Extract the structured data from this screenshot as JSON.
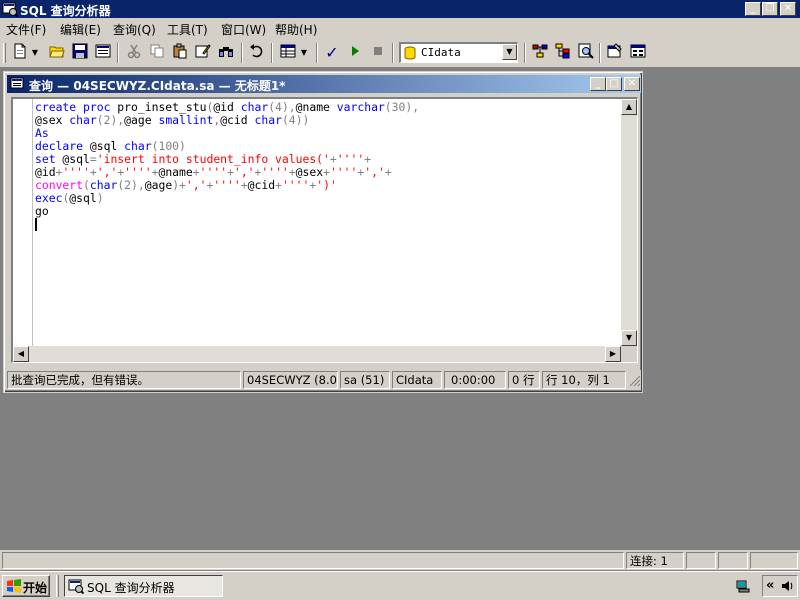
{
  "app": {
    "title": "SQL 查询分析器",
    "window_controls": {
      "minimize": "_",
      "restore": "❐",
      "close": "✕"
    }
  },
  "menu": {
    "items": [
      {
        "label": "文件(F)"
      },
      {
        "label": "编辑(E)"
      },
      {
        "label": "查询(Q)"
      },
      {
        "label": "工具(T)"
      },
      {
        "label": "窗口(W)"
      },
      {
        "label": "帮助(H)"
      }
    ]
  },
  "toolbar": {
    "database_select": "CIdata",
    "icons": [
      "new-query-icon",
      "open-icon",
      "save-icon",
      "load-script-icon",
      "cut-icon",
      "copy-icon",
      "paste-icon",
      "clear-icon",
      "find-icon",
      "undo-icon",
      "results-grid-icon",
      "parse-icon",
      "execute-icon",
      "stop-icon",
      "database-icon",
      "show-plan-icon",
      "object-browser-icon",
      "object-search-icon",
      "properties-icon",
      "current-connection-icon"
    ]
  },
  "query_window": {
    "title": "查询 — 04SECWYZ.CIdata.sa — 无标题1*",
    "code_lines": [
      [
        {
          "t": "create proc",
          "c": "kw"
        },
        {
          "t": " pro_inset_stu",
          "c": ""
        },
        {
          "t": "(",
          "c": "gr"
        },
        {
          "t": "@id ",
          "c": ""
        },
        {
          "t": "char",
          "c": "kw"
        },
        {
          "t": "(4),",
          "c": "gr"
        },
        {
          "t": "@name ",
          "c": ""
        },
        {
          "t": "varchar",
          "c": "kw"
        },
        {
          "t": "(30),",
          "c": "gr"
        }
      ],
      [
        {
          "t": "@sex ",
          "c": ""
        },
        {
          "t": "char",
          "c": "kw"
        },
        {
          "t": "(2),",
          "c": "gr"
        },
        {
          "t": "@age ",
          "c": ""
        },
        {
          "t": "smallint",
          "c": "kw"
        },
        {
          "t": ",",
          "c": "gr"
        },
        {
          "t": "@cid ",
          "c": ""
        },
        {
          "t": "char",
          "c": "kw"
        },
        {
          "t": "(4))",
          "c": "gr"
        }
      ],
      [
        {
          "t": "As",
          "c": "kw"
        }
      ],
      [
        {
          "t": "declare",
          "c": "kw"
        },
        {
          "t": " @sql ",
          "c": ""
        },
        {
          "t": "char",
          "c": "kw"
        },
        {
          "t": "(100)",
          "c": "gr"
        }
      ],
      [
        {
          "t": "set",
          "c": "kw"
        },
        {
          "t": " @sql",
          "c": ""
        },
        {
          "t": "=",
          "c": "gr"
        },
        {
          "t": "'insert into student_info values('",
          "c": "str"
        },
        {
          "t": "+",
          "c": "gr"
        },
        {
          "t": "''''",
          "c": "str"
        },
        {
          "t": "+",
          "c": "gr"
        }
      ],
      [
        {
          "t": "@id",
          "c": ""
        },
        {
          "t": "+",
          "c": "gr"
        },
        {
          "t": "''''",
          "c": "str"
        },
        {
          "t": "+",
          "c": "gr"
        },
        {
          "t": "','",
          "c": "str"
        },
        {
          "t": "+",
          "c": "gr"
        },
        {
          "t": "''''",
          "c": "str"
        },
        {
          "t": "+",
          "c": "gr"
        },
        {
          "t": "@name",
          "c": ""
        },
        {
          "t": "+",
          "c": "gr"
        },
        {
          "t": "''''",
          "c": "str"
        },
        {
          "t": "+",
          "c": "gr"
        },
        {
          "t": "','",
          "c": "str"
        },
        {
          "t": "+",
          "c": "gr"
        },
        {
          "t": "''''",
          "c": "str"
        },
        {
          "t": "+",
          "c": "gr"
        },
        {
          "t": "@sex",
          "c": ""
        },
        {
          "t": "+",
          "c": "gr"
        },
        {
          "t": "''''",
          "c": "str"
        },
        {
          "t": "+",
          "c": "gr"
        },
        {
          "t": "','",
          "c": "str"
        },
        {
          "t": "+",
          "c": "gr"
        }
      ],
      [
        {
          "t": "convert",
          "c": "fn"
        },
        {
          "t": "(",
          "c": "gr"
        },
        {
          "t": "char",
          "c": "kw"
        },
        {
          "t": "(2),",
          "c": "gr"
        },
        {
          "t": "@age",
          "c": ""
        },
        {
          "t": ")+",
          "c": "gr"
        },
        {
          "t": "','",
          "c": "str"
        },
        {
          "t": "+",
          "c": "gr"
        },
        {
          "t": "''''",
          "c": "str"
        },
        {
          "t": "+",
          "c": "gr"
        },
        {
          "t": "@cid",
          "c": ""
        },
        {
          "t": "+",
          "c": "gr"
        },
        {
          "t": "''''",
          "c": "str"
        },
        {
          "t": "+",
          "c": "gr"
        },
        {
          "t": "')'",
          "c": "str"
        }
      ],
      [
        {
          "t": "exec",
          "c": "kw"
        },
        {
          "t": "(",
          "c": "gr"
        },
        {
          "t": "@sql",
          "c": ""
        },
        {
          "t": ")",
          "c": "gr"
        }
      ],
      [
        {
          "t": "go",
          "c": ""
        }
      ],
      [
        {
          "t": "",
          "c": ""
        }
      ]
    ],
    "status": {
      "message": "批查询已完成，但有错误。",
      "server": "04SECWYZ (8.0)",
      "user": "sa (51)",
      "database": "CIdata",
      "elapsed": "0:00:00",
      "rows": "0 行",
      "position": "行 10，列 1"
    }
  },
  "main_status": {
    "connections": "连接: 1"
  },
  "taskbar": {
    "start_label": "开始",
    "task_label": "SQL 查询分析器",
    "tray_expand": "«"
  }
}
